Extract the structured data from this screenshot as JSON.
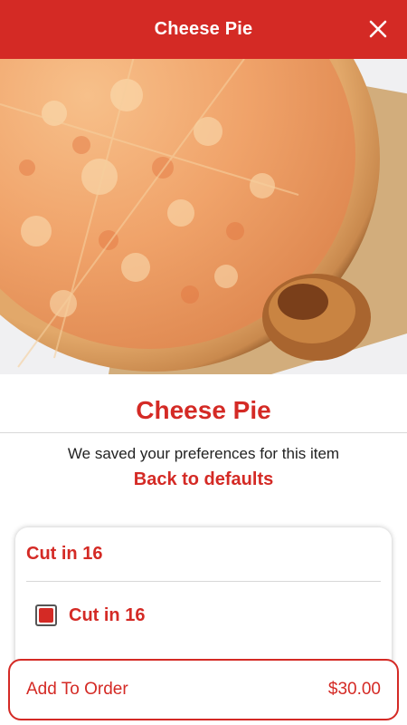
{
  "header": {
    "title": "Cheese Pie",
    "close_icon": "close-icon"
  },
  "hero": {
    "image_subject": "cheese pizza on wooden board"
  },
  "item": {
    "title": "Cheese Pie",
    "saved_message": "We saved your preferences for this item",
    "defaults_link": "Back to defaults"
  },
  "options": {
    "group_title": "Cut in 16",
    "items": [
      {
        "label": "Cut in 16",
        "checked": true
      }
    ]
  },
  "order": {
    "label": "Add To Order",
    "price": "$30.00"
  },
  "colors": {
    "brand": "#d42a25",
    "text": "#222222",
    "divider": "#d8d8d8"
  }
}
